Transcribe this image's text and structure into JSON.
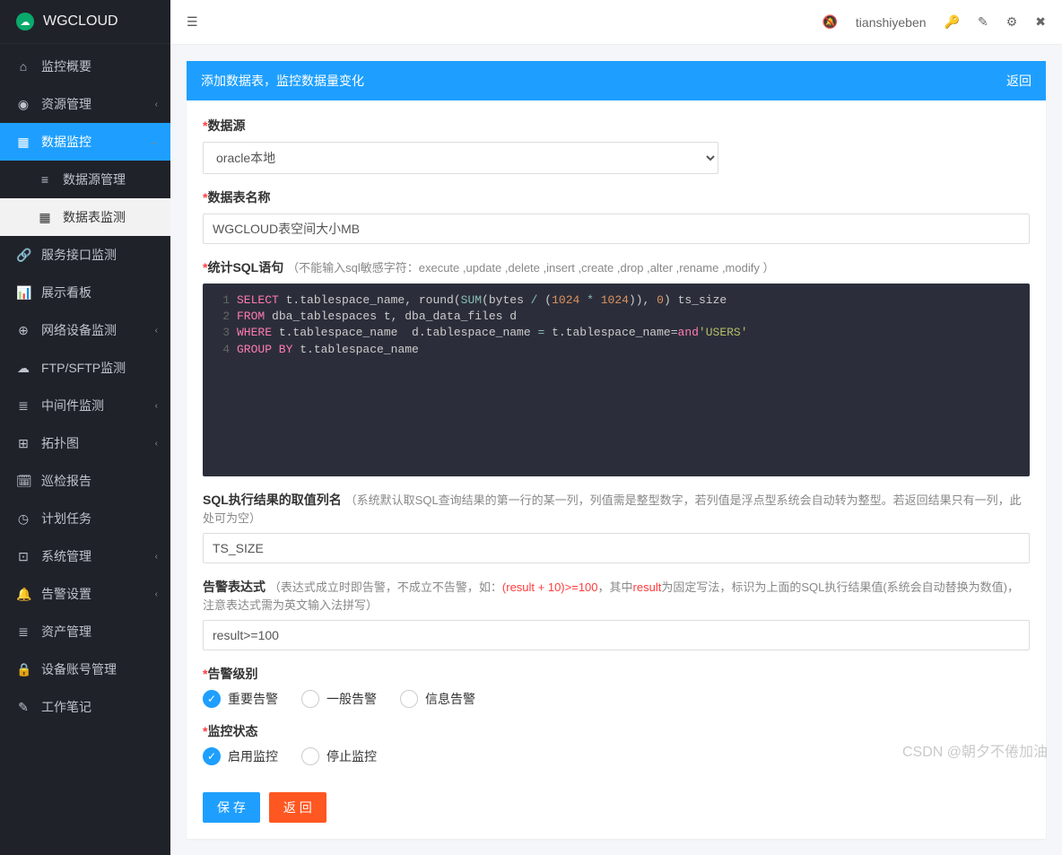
{
  "brand": "WGCLOUD",
  "top": {
    "username": "tianshiyeben"
  },
  "sidebar": {
    "items": [
      {
        "icon": "⌂",
        "label": "监控概要",
        "type": "item"
      },
      {
        "icon": "◉",
        "label": "资源管理",
        "type": "parent"
      },
      {
        "icon": "▦",
        "label": "数据监控",
        "type": "active-parent"
      },
      {
        "icon": "≡",
        "label": "数据源管理",
        "type": "sub"
      },
      {
        "icon": "▦",
        "label": "数据表监测",
        "type": "sub-active"
      },
      {
        "icon": "🔗",
        "label": "服务接口监测",
        "type": "item"
      },
      {
        "icon": "📊",
        "label": "展示看板",
        "type": "item"
      },
      {
        "icon": "⊕",
        "label": "网络设备监测",
        "type": "parent"
      },
      {
        "icon": "☁",
        "label": "FTP/SFTP监测",
        "type": "item"
      },
      {
        "icon": "≣",
        "label": "中间件监测",
        "type": "parent"
      },
      {
        "icon": "⊞",
        "label": "拓扑图",
        "type": "parent"
      },
      {
        "icon": "🗓",
        "label": "巡检报告",
        "type": "item"
      },
      {
        "icon": "◷",
        "label": "计划任务",
        "type": "item"
      },
      {
        "icon": "⊡",
        "label": "系统管理",
        "type": "parent"
      },
      {
        "icon": "🔔",
        "label": "告警设置",
        "type": "parent"
      },
      {
        "icon": "≣",
        "label": "资产管理",
        "type": "item"
      },
      {
        "icon": "🔒",
        "label": "设备账号管理",
        "type": "item"
      },
      {
        "icon": "✎",
        "label": "工作笔记",
        "type": "item"
      }
    ]
  },
  "card": {
    "title": "添加数据表，监控数据量变化",
    "back": "返回"
  },
  "form": {
    "datasource": {
      "label": "数据源",
      "value": "oracle本地"
    },
    "tablename": {
      "label": "数据表名称",
      "value": "WGCLOUD表空间大小MB"
    },
    "sql": {
      "label": "统计SQL语句",
      "hint": "（不能输入sql敏感字符：execute ,update ,delete ,insert ,create ,drop ,alter ,rename ,modify ）",
      "lines": [
        {
          "n": "1",
          "kw1": "SELECT",
          "txt1": " t.tablespace_name, round(",
          "fn": "SUM",
          "txt2": "(bytes ",
          "op1": "/",
          "txt3": " (",
          "num1": "1024",
          "op2": " * ",
          "num2": "1024",
          "txt4": ")), ",
          "num3": "0",
          "txt5": ") ts_size"
        },
        {
          "n": "2",
          "kw1": "FROM",
          "txt1": " dba_tablespaces t, dba_data_files d"
        },
        {
          "n": "3",
          "kw1": "WHERE",
          "txt1": " t.tablespace_name ",
          "op1": "=",
          "txt2": " d.tablespace_name ",
          "kw2": "and",
          "txt3": " t.tablespace_name=",
          "str": "'USERS'"
        },
        {
          "n": "4",
          "kw1": "GROUP BY",
          "txt1": " t.tablespace_name"
        }
      ]
    },
    "result_col": {
      "label": "SQL执行结果的取值列名",
      "hint": "（系统默认取SQL查询结果的第一行的某一列，列值需是整型数字，若列值是浮点型系统会自动转为整型。若返回结果只有一列，此处可为空）",
      "value": "TS_SIZE"
    },
    "alarm_expr": {
      "label": "告警表达式",
      "hint_pre": "（表达式成立时即告警，不成立不告警，如：",
      "hint_code": "(result + 10)>=100",
      "hint_mid": "，其中",
      "hint_code2": "result",
      "hint_post": "为固定写法，标识为上面的SQL执行结果值(系统会自动替换为数值)，注意表达式需为英文输入法拼写）",
      "value": "result>=100"
    },
    "alarm_level": {
      "label": "告警级别",
      "options": [
        "重要告警",
        "一般告警",
        "信息告警"
      ],
      "selected": 0
    },
    "monitor_status": {
      "label": "监控状态",
      "options": [
        "启用监控",
        "停止监控"
      ],
      "selected": 0
    },
    "save_btn": "保 存",
    "back_btn": "返 回"
  },
  "watermark": "CSDN @朝夕不倦加油"
}
